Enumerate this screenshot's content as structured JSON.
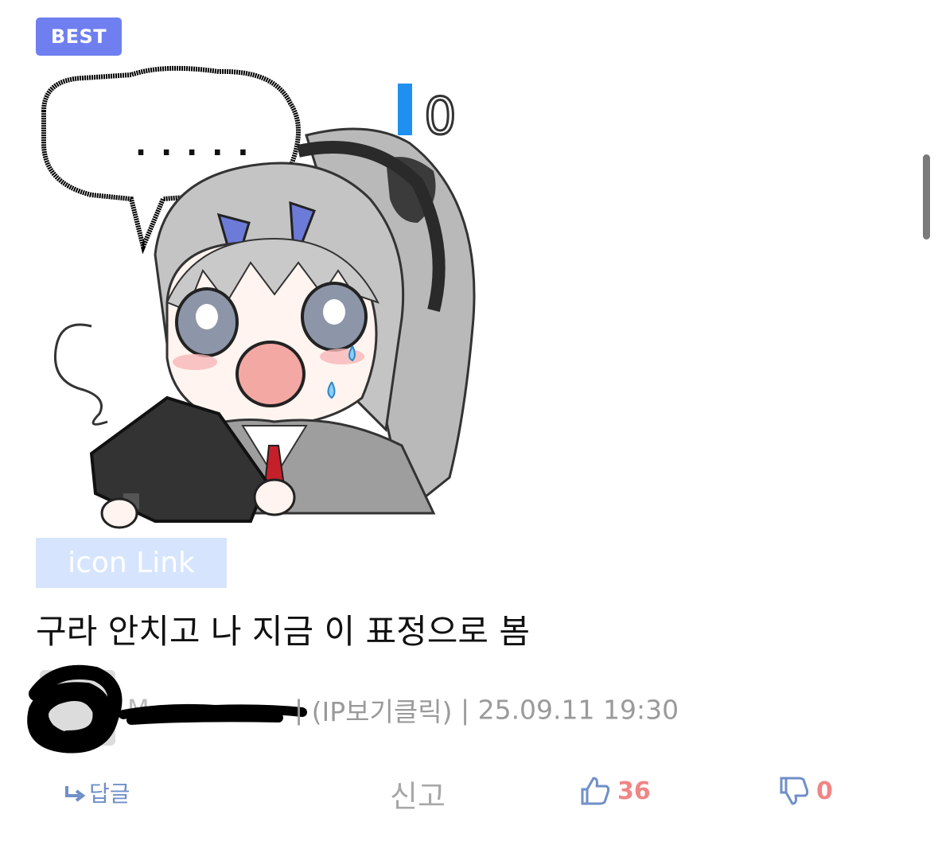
{
  "badge": {
    "label": "BEST"
  },
  "emoticon": {
    "speech_bubble_text": ".....",
    "counter_text": "0",
    "description": "sticker"
  },
  "icon_link": {
    "label": "icon Link"
  },
  "comment": {
    "text": "구라 안치고 나 지금 이 표정으로 봄"
  },
  "meta": {
    "username_partial": "M",
    "ip_label": "(IP보기클릭)",
    "separator": "|",
    "datetime": "25.09.11 19:30"
  },
  "actions": {
    "reply_label": "답글",
    "report_label": "신고",
    "like_count": "36",
    "dislike_count": "0"
  },
  "colors": {
    "badge_bg": "#6f7ff0",
    "link_bg": "#d6e5fd",
    "count_color": "#f08585",
    "action_blue": "#6f8fc9"
  }
}
